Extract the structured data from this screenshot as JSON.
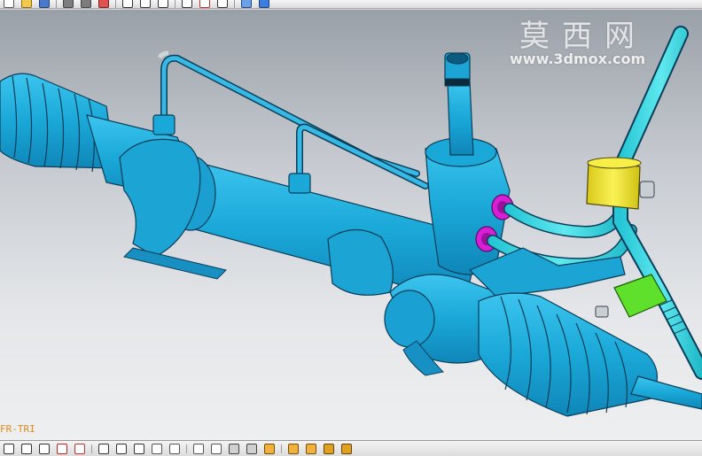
{
  "watermark": {
    "title": "莫西网",
    "url": "www.3dmox.com"
  },
  "view": {
    "orientation_label": "FR-TRI"
  },
  "colors": {
    "part_body": "#1aa8d8",
    "part_outline": "#0a3d57",
    "hose": "#2fd6e0",
    "clamp_yellow": "#f4ea2a",
    "clamp_green": "#5fe02a",
    "fitting_magenta": "#d61fd6",
    "background_top": "#9aa0a8",
    "background_bottom": "#eeeff0"
  },
  "top_toolbar": {
    "icons": [
      "new-icon",
      "open-icon",
      "save-icon",
      "undo-icon",
      "redo-icon",
      "snap-icon",
      "select-icon",
      "line-icon",
      "arc-icon",
      "rotate-icon",
      "point-icon",
      "help-icon",
      "shaded-icon",
      "cube-icon"
    ]
  },
  "bottom_toolbar": {
    "icons": [
      "circle-icon",
      "arc-icon",
      "line-icon",
      "rectangle-icon",
      "point-icon",
      "cross-icon",
      "fillet-icon",
      "chamfer-icon",
      "trim-icon",
      "extend-icon",
      "offset-icon",
      "mirror-icon",
      "constraint-icon",
      "dimension-icon",
      "view-front-icon",
      "view-top-icon",
      "view-right-icon",
      "view-iso-icon",
      "shade-icon"
    ]
  }
}
